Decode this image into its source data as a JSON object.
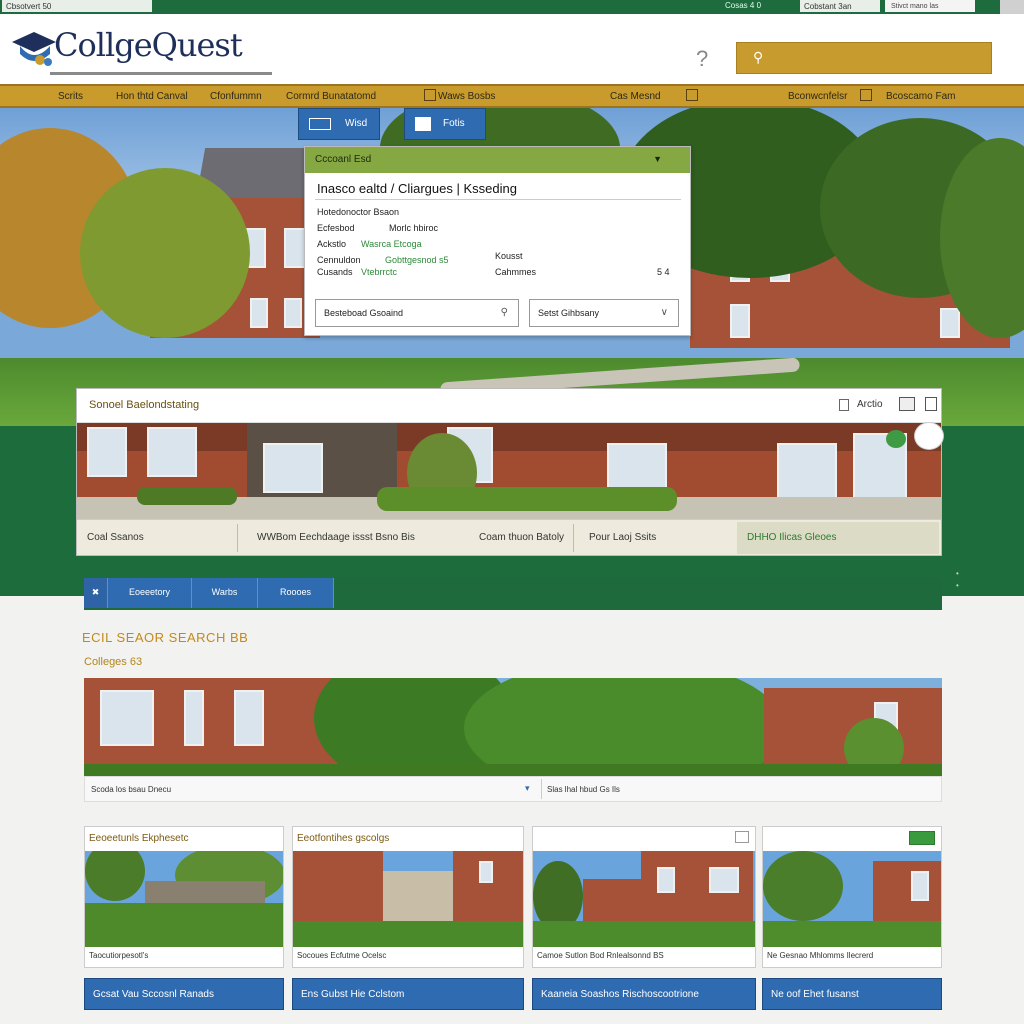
{
  "topbar": {
    "left_text": "Cbsotvert 50",
    "mid_text": "Cosas 4 0",
    "mid2_text": "Cobstant 3an",
    "right_text": "Stivct mano las"
  },
  "header": {
    "logo_text": "CollgeQuest",
    "help_icon": "?",
    "search_icon": "magnifier-icon"
  },
  "nav": {
    "items": [
      "Scrits",
      "Hon thtd Canval",
      "Cfonfummn",
      "Cormrd Bunatatomd",
      "Waws Bosbs",
      "Cas Mesnd",
      "Bconwcnfelsr",
      "Bcoscamo Fam"
    ]
  },
  "hero_tabs": {
    "tab1": "Wisd",
    "tab2": "Fotis"
  },
  "search_panel": {
    "header": "Cccoanl Esd",
    "title": "Inasco ealtd / Cliargues | Ksseding",
    "row1_label": "Hotedonoctor Bsaon",
    "row2_label": "Ecfesbod",
    "row2_value": "Morlc hbiroc",
    "row3_label": "Ackstlo",
    "row3_value": "Wasrca Etcoga",
    "row4_label": "Cennuldon",
    "row4_value": "Gobttgesnod s5",
    "row5_label": "Cusands",
    "row5_value": "Vtebrrctc",
    "right1": "Kousst",
    "right2": "Cahmmes",
    "right2_val": "5 4",
    "select1": "Besteboad Gsoaind",
    "select2": "Setst Gihbsany"
  },
  "featured": {
    "title": "Sonoel Baelondstating",
    "arrow_label": "Arctio",
    "bar_items": [
      "Coal Ssanos",
      "WWBom Eechdaage issst Bsno Bis",
      "Coam thuon Batoly",
      "Pour Laoj Ssits",
      "DHHO Ilicas Gleoes"
    ]
  },
  "filter_tabs": [
    "Eoeeetory",
    "Warbs",
    "Roooes"
  ],
  "results": {
    "title": "ECIL SEAOR SEARCH BB",
    "subtitle": "Colleges 63",
    "wide_caption_left": "Scoda los bsau Dnecu",
    "wide_caption_right": "Slas lhal hbud Gs Ils"
  },
  "cards": [
    {
      "title": "Eeoeetunls Ekphesetc",
      "caption": "Taocutiorpesotl's"
    },
    {
      "title": "Eeotfontihes gscolgs",
      "caption": "Socoues Ecfutme Ocelsc"
    },
    {
      "title": "",
      "caption": "Camoe Sutlon Bod Rnlealsonnd BS"
    },
    {
      "title": "",
      "caption": "Ne Gesnao Mhlomms Ilecrerd"
    }
  ],
  "card_buttons": [
    "Gcsat Vau Sccosnl Ranads",
    "Ens Gubst Hie Cclstom",
    "Kaaneia Soashos Rischoscootrione",
    "Ne oof Ehet fusanst"
  ],
  "colors": {
    "brand_green": "#1d6c3c",
    "brand_gold": "#c99a2c",
    "brand_blue": "#2f6bb0",
    "brand_navy": "#1d2f5a"
  }
}
